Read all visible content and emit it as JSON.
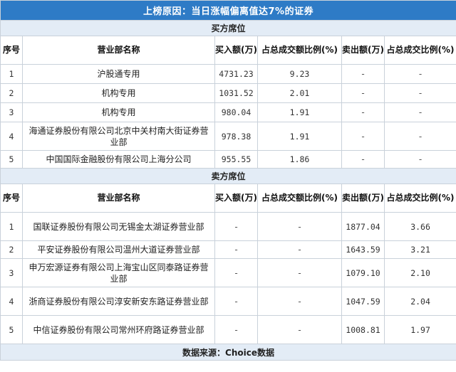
{
  "title": "上榜原因：当日涨幅偏离值达7%的证券",
  "buy_section": {
    "label": "买方席位",
    "headers": [
      "序号",
      "营业部名称",
      "买入额(万)",
      "占总成交额比例(%)",
      "卖出额(万)",
      "占总成交比例(%)"
    ],
    "rows": [
      {
        "idx": "1",
        "name": "沪股通专用",
        "buy": "4731.23",
        "buy_pct": "9.23",
        "sell": "-",
        "sell_pct": "-"
      },
      {
        "idx": "2",
        "name": "机构专用",
        "buy": "1031.52",
        "buy_pct": "2.01",
        "sell": "-",
        "sell_pct": "-"
      },
      {
        "idx": "3",
        "name": "机构专用",
        "buy": "980.04",
        "buy_pct": "1.91",
        "sell": "-",
        "sell_pct": "-"
      },
      {
        "idx": "4",
        "name": "海通证券股份有限公司北京中关村南大街证券营业部",
        "buy": "978.38",
        "buy_pct": "1.91",
        "sell": "-",
        "sell_pct": "-"
      },
      {
        "idx": "5",
        "name": "中国国际金融股份有限公司上海分公司",
        "buy": "955.55",
        "buy_pct": "1.86",
        "sell": "-",
        "sell_pct": "-"
      }
    ]
  },
  "sell_section": {
    "label": "卖方席位",
    "headers": [
      "序号",
      "营业部名称",
      "买入额(万)",
      "占总成交额比例(%)",
      "卖出额(万)",
      "占总成交比例(%)"
    ],
    "rows": [
      {
        "idx": "1",
        "name": "国联证券股份有限公司无锡金太湖证券营业部",
        "buy": "-",
        "buy_pct": "-",
        "sell": "1877.04",
        "sell_pct": "3.66"
      },
      {
        "idx": "2",
        "name": "平安证券股份有限公司温州大道证券营业部",
        "buy": "-",
        "buy_pct": "-",
        "sell": "1643.59",
        "sell_pct": "3.21"
      },
      {
        "idx": "3",
        "name": "申万宏源证券有限公司上海宝山区同泰路证券营业部",
        "buy": "-",
        "buy_pct": "-",
        "sell": "1079.10",
        "sell_pct": "2.10"
      },
      {
        "idx": "4",
        "name": "浙商证券股份有限公司淳安新安东路证券营业部",
        "buy": "-",
        "buy_pct": "-",
        "sell": "1047.59",
        "sell_pct": "2.04"
      },
      {
        "idx": "5",
        "name": "中信证券股份有限公司常州环府路证券营业部",
        "buy": "-",
        "buy_pct": "-",
        "sell": "1008.81",
        "sell_pct": "1.97"
      }
    ]
  },
  "footer": "数据来源：Choice数据",
  "colors": {
    "title_bg": "#2e7bc6",
    "section_bg": "#e3ecf6",
    "border": "#c9d1da"
  }
}
